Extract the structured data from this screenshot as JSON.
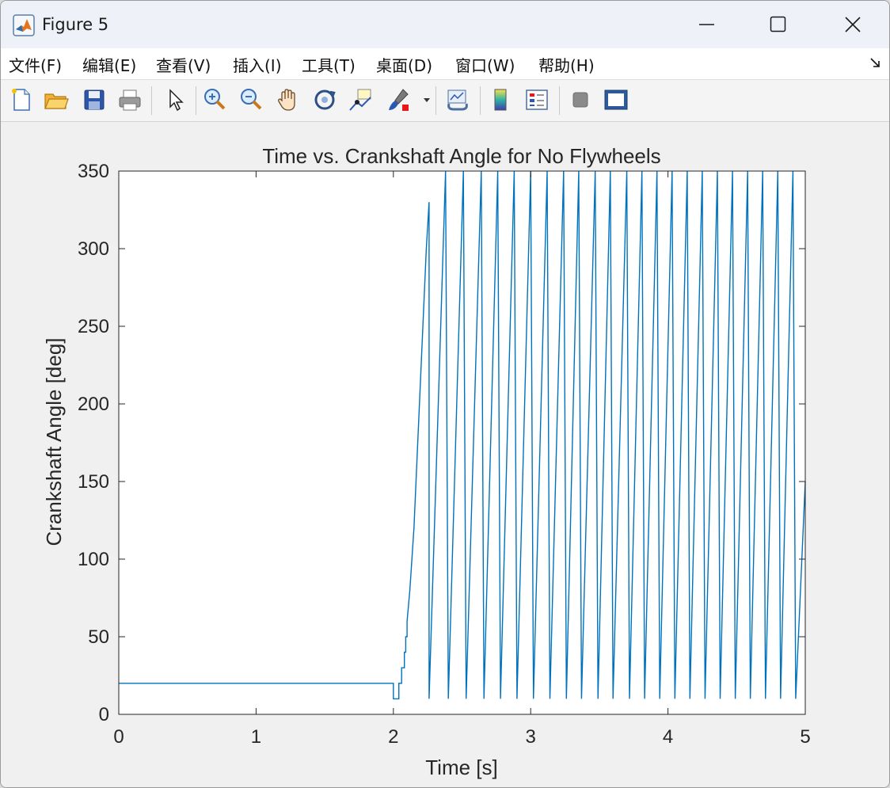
{
  "window": {
    "title": "Figure 5",
    "controls": {
      "minimize": "minimize",
      "maximize": "maximize",
      "close": "close"
    }
  },
  "menu": {
    "items": [
      {
        "label": "文件(F)",
        "name": "menu-file"
      },
      {
        "label": "编辑(E)",
        "name": "menu-edit"
      },
      {
        "label": "查看(V)",
        "name": "menu-view"
      },
      {
        "label": "插入(I)",
        "name": "menu-insert"
      },
      {
        "label": "工具(T)",
        "name": "menu-tools"
      },
      {
        "label": "桌面(D)",
        "name": "menu-desktop"
      },
      {
        "label": "窗口(W)",
        "name": "menu-window"
      },
      {
        "label": "帮助(H)",
        "name": "menu-help"
      }
    ]
  },
  "toolbar": {
    "icons": [
      "new-figure-icon",
      "open-file-icon",
      "save-icon",
      "print-icon",
      "pointer-icon",
      "zoom-in-icon",
      "zoom-out-icon",
      "pan-hand-icon",
      "rotate-3d-icon",
      "data-cursor-icon",
      "brush-icon",
      "brush-dropdown-icon",
      "link-plot-icon",
      "colorbar-icon",
      "legend-icon",
      "hide-plot-tools-icon",
      "show-plot-tools-icon"
    ]
  },
  "colors": {
    "line": "#0072bd",
    "axes_bg": "#ffffff",
    "figure_bg": "#f0f0f0",
    "axis": "#262626"
  },
  "chart_data": {
    "type": "line",
    "title": "Time vs. Crankshaft Angle for No Flywheels",
    "xlabel": "Time [s]",
    "ylabel": "Crankshaft Angle [deg]",
    "xlim": [
      0,
      5
    ],
    "ylim": [
      0,
      350
    ],
    "xticks": [
      0,
      1,
      2,
      3,
      4,
      5
    ],
    "yticks": [
      0,
      50,
      100,
      150,
      200,
      250,
      300,
      350
    ],
    "grid": false,
    "legend": "none",
    "series": [
      {
        "color": "#0072bd",
        "points": [
          [
            0,
            20
          ],
          [
            2.0,
            20
          ],
          [
            2.0,
            10
          ],
          [
            2.04,
            10
          ],
          [
            2.04,
            20
          ],
          [
            2.06,
            20
          ],
          [
            2.06,
            30
          ],
          [
            2.08,
            30
          ],
          [
            2.08,
            40
          ],
          [
            2.09,
            40
          ],
          [
            2.09,
            50
          ],
          [
            2.1,
            50
          ],
          [
            2.1,
            60
          ],
          [
            2.12,
            80
          ],
          [
            2.15,
            120
          ],
          [
            2.18,
            180
          ],
          [
            2.21,
            240
          ],
          [
            2.24,
            300
          ],
          [
            2.26,
            330
          ],
          [
            2.26,
            10
          ],
          [
            2.38,
            350
          ],
          [
            2.4,
            10
          ],
          [
            2.51,
            350
          ],
          [
            2.53,
            10
          ],
          [
            2.64,
            350
          ],
          [
            2.66,
            10
          ],
          [
            2.76,
            350
          ],
          [
            2.78,
            10
          ],
          [
            2.88,
            350
          ],
          [
            2.9,
            10
          ],
          [
            3.0,
            350
          ],
          [
            3.02,
            10
          ],
          [
            3.12,
            350
          ],
          [
            3.14,
            10
          ],
          [
            3.24,
            350
          ],
          [
            3.26,
            10
          ],
          [
            3.35,
            350
          ],
          [
            3.37,
            10
          ],
          [
            3.47,
            350
          ],
          [
            3.49,
            10
          ],
          [
            3.58,
            350
          ],
          [
            3.6,
            10
          ],
          [
            3.7,
            350
          ],
          [
            3.72,
            10
          ],
          [
            3.81,
            350
          ],
          [
            3.83,
            10
          ],
          [
            3.92,
            350
          ],
          [
            3.94,
            10
          ],
          [
            4.03,
            350
          ],
          [
            4.05,
            10
          ],
          [
            4.14,
            350
          ],
          [
            4.16,
            10
          ],
          [
            4.25,
            350
          ],
          [
            4.27,
            10
          ],
          [
            4.36,
            350
          ],
          [
            4.38,
            10
          ],
          [
            4.47,
            350
          ],
          [
            4.49,
            10
          ],
          [
            4.58,
            350
          ],
          [
            4.6,
            10
          ],
          [
            4.69,
            350
          ],
          [
            4.71,
            10
          ],
          [
            4.8,
            350
          ],
          [
            4.82,
            10
          ],
          [
            4.91,
            350
          ],
          [
            4.93,
            10
          ],
          [
            5.0,
            150
          ]
        ]
      }
    ]
  }
}
